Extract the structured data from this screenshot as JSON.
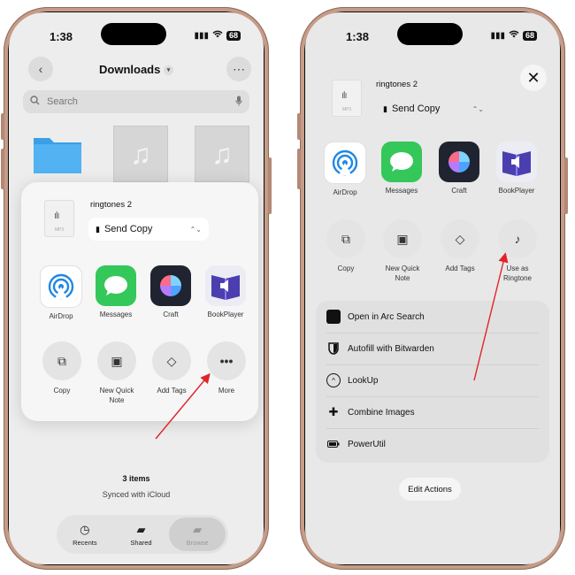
{
  "status": {
    "time": "1:38",
    "battery": "68"
  },
  "left": {
    "header": {
      "title": "Downloads"
    },
    "search": {
      "placeholder": "Search"
    },
    "file": {
      "name": "ringtones 2",
      "ext": "MP3"
    },
    "send_copy": "Send Copy",
    "apps": [
      "AirDrop",
      "Messages",
      "Craft",
      "BookPlayer"
    ],
    "actions": [
      "Copy",
      "New Quick Note",
      "Add Tags",
      "More"
    ],
    "footer": {
      "count": "3 items",
      "sync": "Synced with iCloud"
    },
    "tabs": [
      {
        "label": "Recents",
        "icon": "clock-icon"
      },
      {
        "label": "Shared",
        "icon": "shared-folder-icon"
      },
      {
        "label": "Browse",
        "icon": "folder-icon"
      }
    ]
  },
  "right": {
    "file": {
      "name": "ringtones 2",
      "ext": "MP3"
    },
    "send_copy": "Send Copy",
    "apps": [
      "AirDrop",
      "Messages",
      "Craft",
      "BookPlayer"
    ],
    "actions": [
      "Copy",
      "New Quick Note",
      "Add Tags",
      "Use as Ringtone"
    ],
    "menu": [
      {
        "label": "Open in Arc Search",
        "icon": "arc-search-icon"
      },
      {
        "label": "Autofill with Bitwarden",
        "icon": "bitwarden-shield-icon"
      },
      {
        "label": "LookUp",
        "icon": "lookup-icon"
      },
      {
        "label": "Combine Images",
        "icon": "puzzle-icon"
      },
      {
        "label": "PowerUtil",
        "icon": "battery-icon"
      }
    ],
    "edit_actions": "Edit Actions"
  },
  "colors": {
    "arrow": "#e0242a",
    "folder": "#3aa0e6",
    "messages": "#34c759"
  }
}
